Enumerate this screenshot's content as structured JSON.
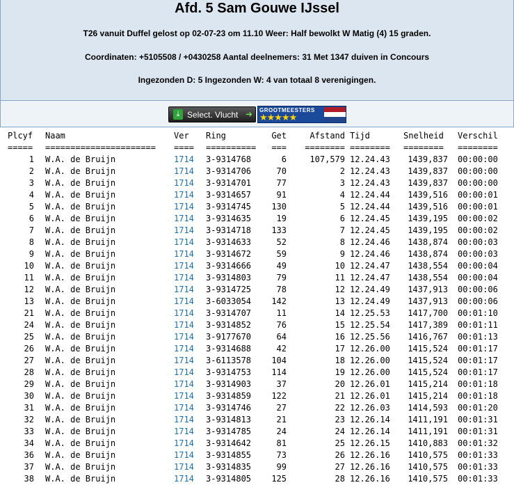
{
  "header": {
    "title": "Afd. 5 Sam Gouwe IJssel",
    "line1": "T26 vanuit Duffel gelost op 02-07-23 om 11.10 Weer: Half bewolkt W Matig (4) 15 graden.",
    "line2": "Coordinaten: +5105508 / +0430258 Aantal deelnemers: 31 Met 1347 duiven in Concours",
    "line3": "Ingezonden D: 5 Ingezonden W: 4 van totaal 8 verenigingen."
  },
  "toolbar": {
    "select_label": "Select. Vlucht",
    "badge_text": "GROOTMEESTERS",
    "badge_stars": "★★★★★",
    "flag_colors": [
      "#ae1c28",
      "#ffffff",
      "#21468b"
    ]
  },
  "table": {
    "columns": [
      "Plcyf",
      "Naam",
      "Ver",
      "Ring",
      "Get",
      "Afstand",
      "Tijd",
      "Snelheid",
      "Verschil"
    ],
    "separators": [
      "=====",
      "======================",
      "====",
      "==========",
      "===",
      "========",
      "========",
      "========",
      "========"
    ],
    "rows": [
      [
        "1",
        "W.A. de Bruijn",
        "1714",
        "3-9314768",
        "6",
        "107,579",
        "12.24.43",
        "1439,837",
        "00:00:00"
      ],
      [
        "2",
        "W.A. de Bruijn",
        "1714",
        "3-9314706",
        "70",
        "2",
        "12.24.43",
        "1439,837",
        "00:00:00"
      ],
      [
        "3",
        "W.A. de Bruijn",
        "1714",
        "3-9314701",
        "77",
        "3",
        "12.24.43",
        "1439,837",
        "00:00:00"
      ],
      [
        "4",
        "W.A. de Bruijn",
        "1714",
        "3-9314657",
        "91",
        "4",
        "12.24.44",
        "1439,516",
        "00:00:01"
      ],
      [
        "5",
        "W.A. de Bruijn",
        "1714",
        "3-9314745",
        "130",
        "5",
        "12.24.44",
        "1439,516",
        "00:00:01"
      ],
      [
        "6",
        "W.A. de Bruijn",
        "1714",
        "3-9314635",
        "19",
        "6",
        "12.24.45",
        "1439,195",
        "00:00:02"
      ],
      [
        "7",
        "W.A. de Bruijn",
        "1714",
        "3-9314718",
        "133",
        "7",
        "12.24.45",
        "1439,195",
        "00:00:02"
      ],
      [
        "8",
        "W.A. de Bruijn",
        "1714",
        "3-9314633",
        "52",
        "8",
        "12.24.46",
        "1438,874",
        "00:00:03"
      ],
      [
        "9",
        "W.A. de Bruijn",
        "1714",
        "3-9314672",
        "59",
        "9",
        "12.24.46",
        "1438,874",
        "00:00:03"
      ],
      [
        "10",
        "W.A. de Bruijn",
        "1714",
        "3-9314666",
        "49",
        "10",
        "12.24.47",
        "1438,554",
        "00:00:04"
      ],
      [
        "11",
        "W.A. de Bruijn",
        "1714",
        "3-9314803",
        "79",
        "11",
        "12.24.47",
        "1438,554",
        "00:00:04"
      ],
      [
        "12",
        "W.A. de Bruijn",
        "1714",
        "3-9314725",
        "78",
        "12",
        "12.24.49",
        "1437,913",
        "00:00:06"
      ],
      [
        "13",
        "W.A. de Bruijn",
        "1714",
        "3-6033054",
        "142",
        "13",
        "12.24.49",
        "1437,913",
        "00:00:06"
      ],
      [
        "21",
        "W.A. de Bruijn",
        "1714",
        "3-9314707",
        "11",
        "14",
        "12.25.53",
        "1417,700",
        "00:01:10"
      ],
      [
        "24",
        "W.A. de Bruijn",
        "1714",
        "3-9314852",
        "76",
        "15",
        "12.25.54",
        "1417,389",
        "00:01:11"
      ],
      [
        "25",
        "W.A. de Bruijn",
        "1714",
        "3-9177670",
        "64",
        "16",
        "12.25.56",
        "1416,767",
        "00:01:13"
      ],
      [
        "26",
        "W.A. de Bruijn",
        "1714",
        "3-9314688",
        "42",
        "17",
        "12.26.00",
        "1415,524",
        "00:01:17"
      ],
      [
        "27",
        "W.A. de Bruijn",
        "1714",
        "3-6113578",
        "104",
        "18",
        "12.26.00",
        "1415,524",
        "00:01:17"
      ],
      [
        "28",
        "W.A. de Bruijn",
        "1714",
        "3-9314753",
        "114",
        "19",
        "12.26.00",
        "1415,524",
        "00:01:17"
      ],
      [
        "29",
        "W.A. de Bruijn",
        "1714",
        "3-9314903",
        "37",
        "20",
        "12.26.01",
        "1415,214",
        "00:01:18"
      ],
      [
        "30",
        "W.A. de Bruijn",
        "1714",
        "3-9314859",
        "122",
        "21",
        "12.26.01",
        "1415,214",
        "00:01:18"
      ],
      [
        "31",
        "W.A. de Bruijn",
        "1714",
        "3-9314746",
        "27",
        "22",
        "12.26.03",
        "1414,593",
        "00:01:20"
      ],
      [
        "32",
        "W.A. de Bruijn",
        "1714",
        "3-9314813",
        "21",
        "23",
        "12.26.14",
        "1411,191",
        "00:01:31"
      ],
      [
        "33",
        "W.A. de Bruijn",
        "1714",
        "3-9314785",
        "24",
        "24",
        "12.26.14",
        "1411,191",
        "00:01:31"
      ],
      [
        "34",
        "W.A. de Bruijn",
        "1714",
        "3-9314642",
        "81",
        "25",
        "12.26.15",
        "1410,883",
        "00:01:32"
      ],
      [
        "36",
        "W.A. de Bruijn",
        "1714",
        "3-9314855",
        "73",
        "26",
        "12.26.16",
        "1410,575",
        "00:01:33"
      ],
      [
        "37",
        "W.A. de Bruijn",
        "1714",
        "3-9314835",
        "99",
        "27",
        "12.26.16",
        "1410,575",
        "00:01:33"
      ],
      [
        "38",
        "W.A. de Bruijn",
        "1714",
        "3-9314805",
        "125",
        "28",
        "12.26.16",
        "1410,575",
        "00:01:33"
      ]
    ]
  }
}
